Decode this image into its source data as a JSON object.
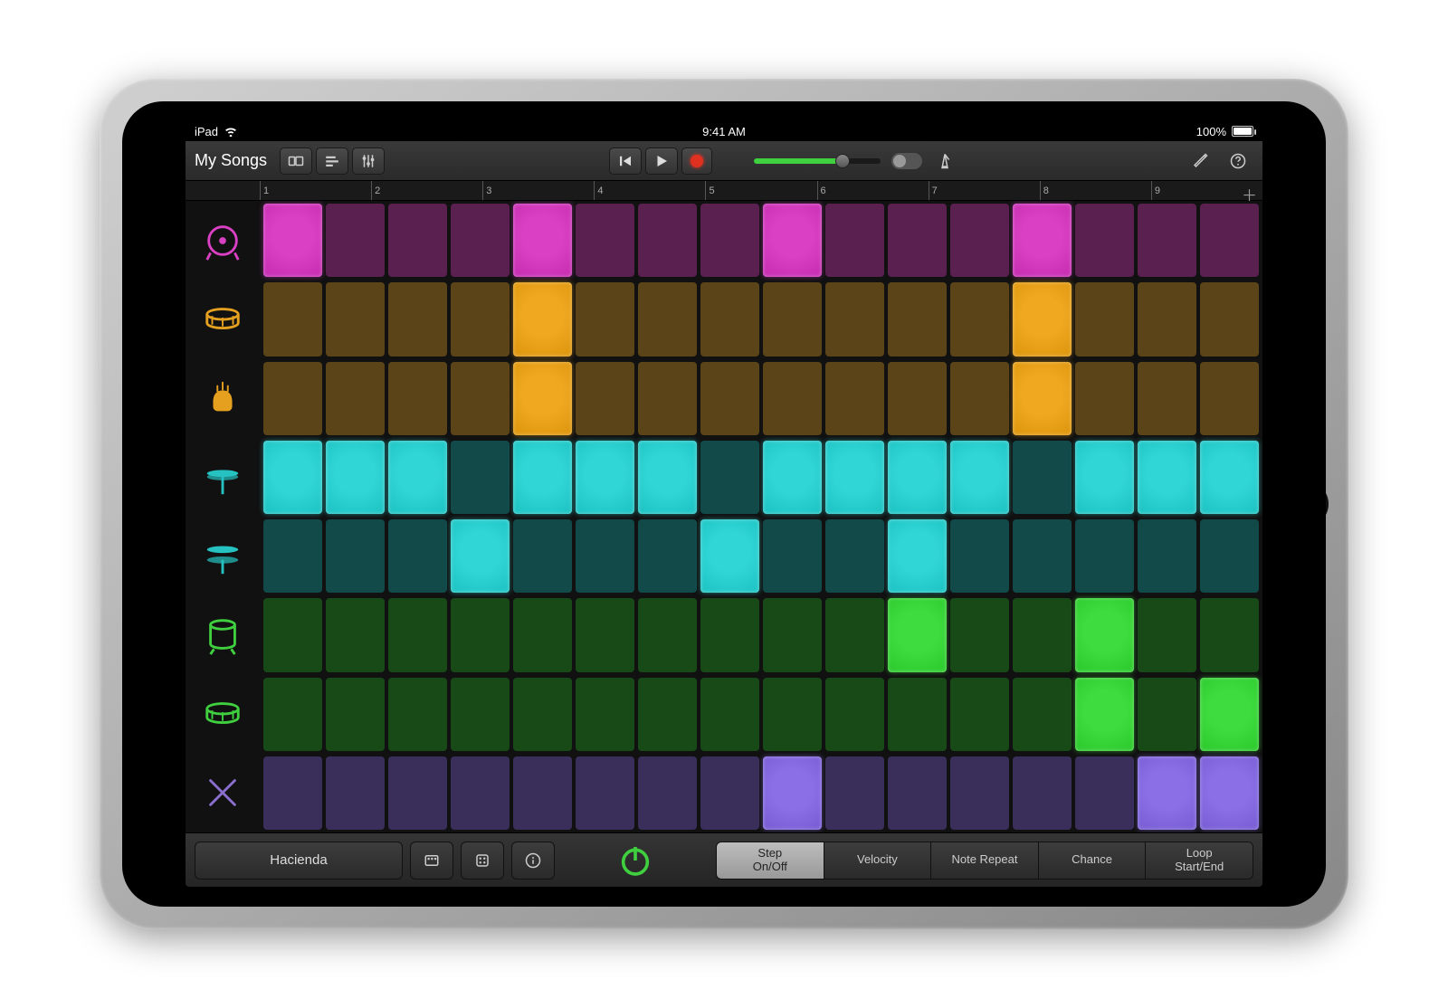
{
  "status": {
    "device": "iPad",
    "time": "9:41 AM",
    "battery": "100%"
  },
  "toolbar": {
    "back_label": "My Songs"
  },
  "ruler": {
    "bars": [
      "1",
      "2",
      "3",
      "4",
      "5",
      "6",
      "7",
      "8",
      "9"
    ]
  },
  "rows": [
    {
      "name": "kick",
      "icon_color": "#d940c4",
      "dim": "#5a2050",
      "bright": "#d940c4",
      "cells": [
        1,
        0,
        0,
        0,
        1,
        0,
        0,
        0,
        1,
        0,
        0,
        0,
        1,
        0,
        0,
        0
      ]
    },
    {
      "name": "snare",
      "icon_color": "#e6a020",
      "dim": "#5a4418",
      "bright": "#f0a820",
      "cells": [
        0,
        0,
        0,
        0,
        1,
        0,
        0,
        0,
        0,
        0,
        0,
        0,
        1,
        0,
        0,
        0
      ]
    },
    {
      "name": "clap",
      "icon_color": "#e6a020",
      "dim": "#5a4418",
      "bright": "#f0a820",
      "cells": [
        0,
        0,
        0,
        0,
        1,
        0,
        0,
        0,
        0,
        0,
        0,
        0,
        1,
        0,
        0,
        0
      ]
    },
    {
      "name": "hihat-closed",
      "icon_color": "#26c2c2",
      "dim": "#124a4a",
      "bright": "#30d5d5",
      "cells": [
        1,
        1,
        1,
        0,
        1,
        1,
        1,
        0,
        1,
        1,
        1,
        1,
        0,
        1,
        1,
        1
      ]
    },
    {
      "name": "hihat-open",
      "icon_color": "#26c2c2",
      "dim": "#124a4a",
      "bright": "#30d5d5",
      "cells": [
        0,
        0,
        0,
        1,
        0,
        0,
        0,
        1,
        0,
        0,
        1,
        0,
        0,
        0,
        0,
        0
      ]
    },
    {
      "name": "tom-low",
      "icon_color": "#3fcf3f",
      "dim": "#184a18",
      "bright": "#3fdc3f",
      "cells": [
        0,
        0,
        0,
        0,
        0,
        0,
        0,
        0,
        0,
        0,
        1,
        0,
        0,
        1,
        0,
        0
      ]
    },
    {
      "name": "tom-mid",
      "icon_color": "#3fcf3f",
      "dim": "#184a18",
      "bright": "#3fdc3f",
      "cells": [
        0,
        0,
        0,
        0,
        0,
        0,
        0,
        0,
        0,
        0,
        0,
        0,
        0,
        1,
        0,
        1
      ]
    },
    {
      "name": "sticks",
      "icon_color": "#8a6fcf",
      "dim": "#3a2f5a",
      "bright": "#8a6fe6",
      "cells": [
        0,
        0,
        0,
        0,
        0,
        0,
        0,
        0,
        1,
        0,
        0,
        0,
        0,
        0,
        1,
        1
      ]
    }
  ],
  "bottom": {
    "preset": "Hacienda",
    "modes": [
      "Step\nOn/Off",
      "Velocity",
      "Note Repeat",
      "Chance",
      "Loop\nStart/End"
    ],
    "active_mode": 0
  }
}
